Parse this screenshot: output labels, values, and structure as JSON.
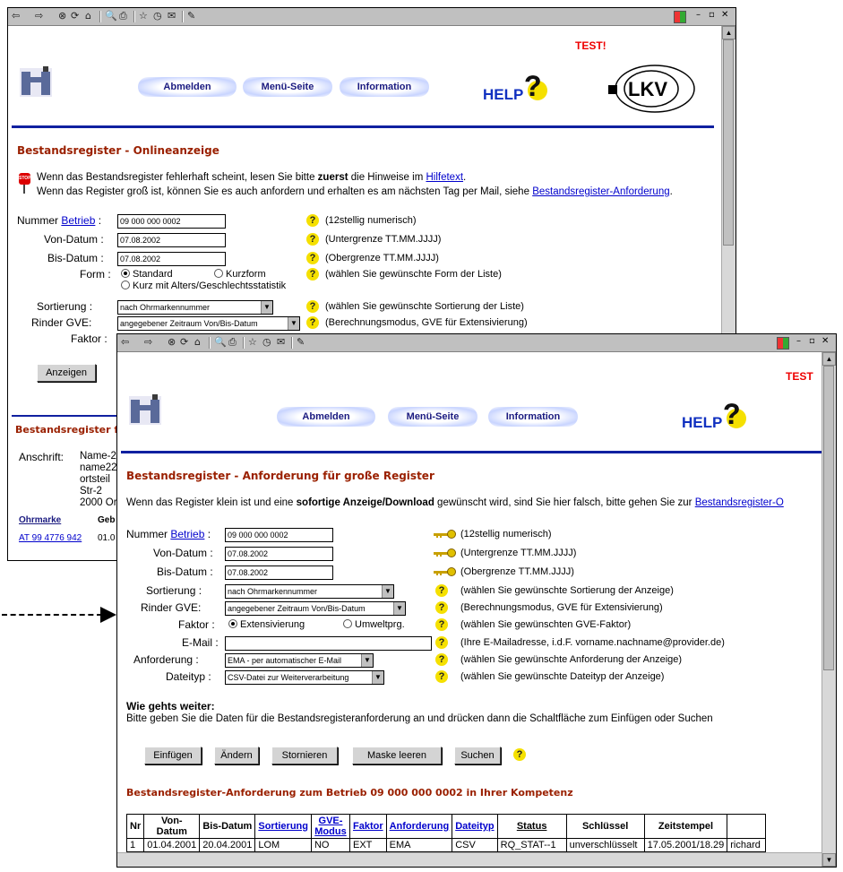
{
  "toolbar": {
    "back": "⇦",
    "forward": "⇨",
    "stop": "⊗",
    "refresh": "⟳",
    "home": "⌂",
    "search": "🔍",
    "print": "⎙",
    "edit": "✎",
    "win_min": "–",
    "win_max": "▫",
    "win_close": "✕"
  },
  "window1": {
    "test_label": "TEST!",
    "nav": {
      "logout": "Abmelden",
      "menu": "Menü-Seite",
      "info": "Information"
    },
    "help_he": "HELP",
    "help_q": "?",
    "lkv": "LKV",
    "heading": "Bestandsregister - Onlineanzeige",
    "stop_icon": "STOP",
    "notice1_pre": "Wenn das Bestandsregister fehlerhaft scheint, lesen Sie bitte ",
    "notice1_bold": "zuerst",
    "notice1_mid": " die Hinweise im ",
    "notice1_link": "Hilfetext",
    "notice1_post": ".",
    "notice2_pre": "Wenn das Register groß ist, können Sie es auch anfordern und erhalten es am nächsten Tag per Mail, siehe ",
    "notice2_link": "Bestandsregister-Anforderung",
    "notice2_post": ".",
    "form": {
      "nummer_label": "Nummer",
      "betrieb_link": "Betrieb",
      "colon": ":",
      "nummer_value": "09 000 000 0002",
      "nummer_hint": "(12stellig numerisch)",
      "von_label": "Von-Datum :",
      "von_value": "07.08.2002",
      "von_hint": "(Untergrenze TT.MM.JJJJ)",
      "bis_label": "Bis-Datum :",
      "bis_value": "07.08.2002",
      "bis_hint": "(Obergrenze TT.MM.JJJJ)",
      "form_label": "Form :",
      "form_opt1": "Standard",
      "form_opt2": "Kurzform",
      "form_opt3": "Kurz mit Alters/Geschlechtsstatistik",
      "form_hint": "(wählen Sie gewünschte Form der Liste)",
      "sort_label": "Sortierung :",
      "sort_value": "nach Ohrmarkennummer",
      "sort_hint": "(wählen Sie gewünschte Sortierung der Liste)",
      "gve_label": "Rinder GVE:",
      "gve_value": "angegebener Zeitraum Von/Bis-Datum",
      "gve_hint": "(Berechnungsmodus, GVE für Extensivierung)",
      "faktor_label": "Faktor :",
      "anzeigen": "Anzeigen"
    },
    "register_heading": "Bestandsregister für",
    "anschrift_label": "Anschrift:",
    "anschrift": [
      "Name-2",
      "name22",
      "ortsteil",
      "Str-2",
      "2000 Or"
    ],
    "col_ohrmarke": "Ohrmarke",
    "col_geb": "Geb",
    "row_ohrmarke": "AT 99 4776 942",
    "row_geb": "01.0"
  },
  "window2": {
    "test_label": "TEST",
    "nav": {
      "logout": "Abmelden",
      "menu": "Menü-Seite",
      "info": "Information"
    },
    "help_he": "HELP",
    "help_q": "?",
    "heading": "Bestandsregister - Anforderung für große Register",
    "intro_pre": "Wenn das Register klein ist und eine ",
    "intro_bold": "sofortige Anzeige/Download",
    "intro_mid": " gewünscht wird, sind Sie hier falsch, bitte gehen Sie zur ",
    "intro_link": "Bestandsregister-O",
    "form": {
      "nummer_label": "Nummer",
      "betrieb_link": "Betrieb",
      "colon": ":",
      "nummer_value": "09 000 000 0002",
      "nummer_hint": "(12stellig numerisch)",
      "von_label": "Von-Datum :",
      "von_value": "07.08.2002",
      "von_hint": "(Untergrenze TT.MM.JJJJ)",
      "bis_label": "Bis-Datum :",
      "bis_value": "07.08.2002",
      "bis_hint": "(Obergrenze TT.MM.JJJJ)",
      "sort_label": "Sortierung :",
      "sort_value": "nach Ohrmarkennummer",
      "sort_hint": "(wählen Sie gewünschte Sortierung der Anzeige)",
      "gve_label": "Rinder GVE:",
      "gve_value": "angegebener Zeitraum Von/Bis-Datum",
      "gve_hint": "(Berechnungsmodus, GVE für Extensivierung)",
      "faktor_label": "Faktor :",
      "faktor_opt1": "Extensivierung",
      "faktor_opt2": "Umweltprg.",
      "faktor_hint": "(wählen Sie gewünschten GVE-Faktor)",
      "email_label": "E-Mail :",
      "email_value": "",
      "email_hint": "(Ihre E-Mailadresse, i.d.F. vorname.nachname@provider.de)",
      "anf_label": "Anforderung :",
      "anf_value": "EMA - per automatischer E-Mail",
      "anf_hint": "(wählen Sie gewünschte Anforderung der Anzeige)",
      "typ_label": "Dateityp :",
      "typ_value": "CSV-Datei zur Weiterverarbeitung",
      "typ_hint": "(wählen Sie gewünschte Dateityp der Anzeige)"
    },
    "next_title": "Wie gehts weiter:",
    "next_text": "Bitte geben Sie die Daten für die Bestandsregisteranforderung an und drücken dann die Schaltfläche zum Einfügen oder Suchen",
    "buttons": {
      "insert": "Einfügen",
      "change": "Ändern",
      "cancel": "Stornieren",
      "clear": "Maske leeren",
      "search": "Suchen"
    },
    "list_heading": "Bestandsregister-Anforderung zum Betrieb 09 000 000 0002 in Ihrer Kompetenz",
    "table": {
      "headers": [
        "Nr",
        "Von-Datum",
        "Bis-Datum",
        "Sortierung",
        "GVE-Modus",
        "Faktor",
        "Anforderung",
        "Dateityp",
        "Status",
        "Schlüssel",
        "Zeitstempel",
        ""
      ],
      "row": [
        "1",
        "01.04.2001",
        "20.04.2001",
        "LOM",
        "NO",
        "EXT",
        "EMA",
        "CSV",
        "RQ_STAT--1",
        "unverschlüsselt",
        "17.05.2001/18.29",
        "richard"
      ]
    }
  },
  "colors": {
    "heading": "#9a2000",
    "link": "#0000cc",
    "bluebar": "#1020a0",
    "test": "#e00000",
    "help_q_bg": "#f5e000"
  }
}
